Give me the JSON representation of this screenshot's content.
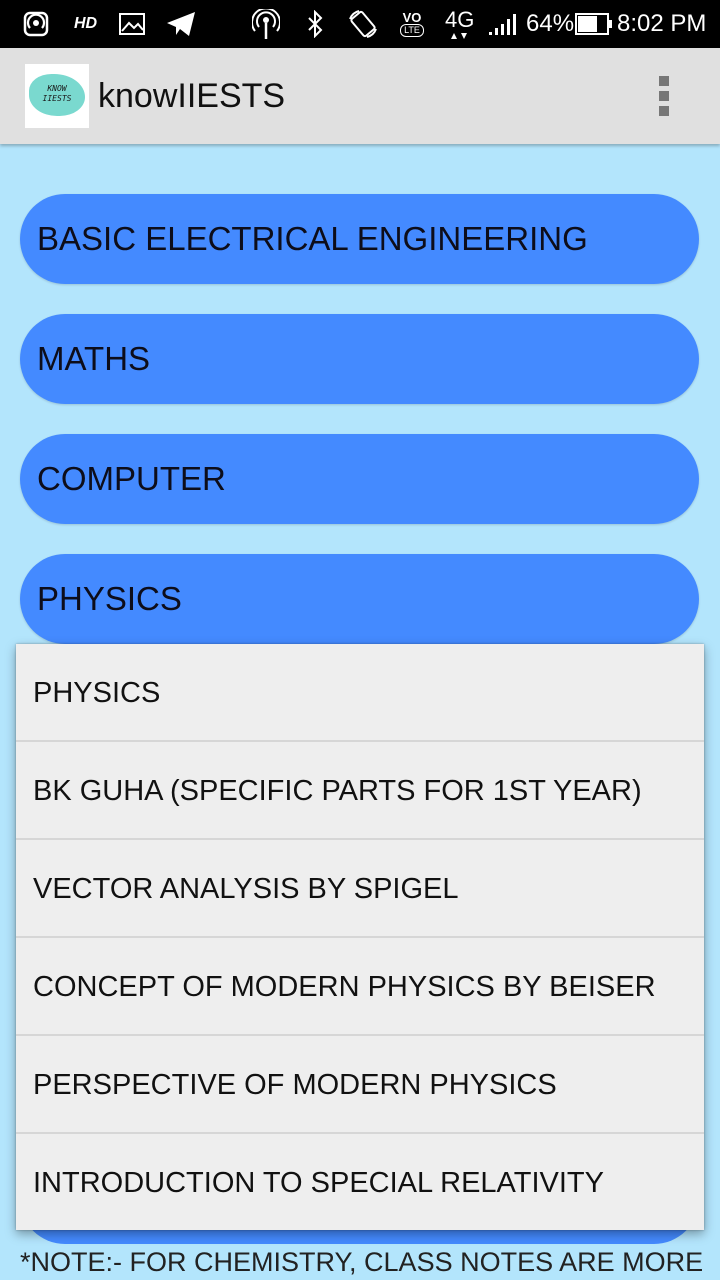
{
  "status_bar": {
    "hd_label": "HD",
    "network_type": "4G",
    "volte_label": "VO",
    "lte_label": "LTE",
    "battery_percent": "64%",
    "time": "8:02 PM",
    "icons": [
      "hotspot-icon",
      "hd-icon",
      "image-icon",
      "telegram-icon",
      "wifi-antenna-icon",
      "bluetooth-icon",
      "rotate-icon",
      "volte-icon",
      "signal-icon",
      "battery-icon"
    ]
  },
  "app_bar": {
    "logo_text_line1": "KNOW",
    "logo_text_line2": "IIESTS",
    "title": "knowIIESTS",
    "overflow_icon": "more-vert-icon"
  },
  "subjects": [
    {
      "label": "BASIC ELECTRICAL ENGINEERING"
    },
    {
      "label": "MATHS"
    },
    {
      "label": "COMPUTER"
    },
    {
      "label": "PHYSICS"
    }
  ],
  "popup_menu": {
    "items": [
      {
        "label": "PHYSICS"
      },
      {
        "label": "BK GUHA (SPECIFIC PARTS FOR 1ST YEAR)"
      },
      {
        "label": "VECTOR ANALYSIS BY SPIGEL"
      },
      {
        "label": "CONCEPT OF MODERN PHYSICS BY BEISER"
      },
      {
        "label": "PERSPECTIVE OF MODERN PHYSICS"
      },
      {
        "label": "INTRODUCTION TO SPECIAL RELATIVITY"
      }
    ]
  },
  "note": "*NOTE:- FOR CHEMISTRY, CLASS NOTES ARE MORE",
  "colors": {
    "background": "#b3e5fc",
    "button": "#448aff",
    "app_bar": "#e0e0e0",
    "popup": "#eeeeee"
  }
}
